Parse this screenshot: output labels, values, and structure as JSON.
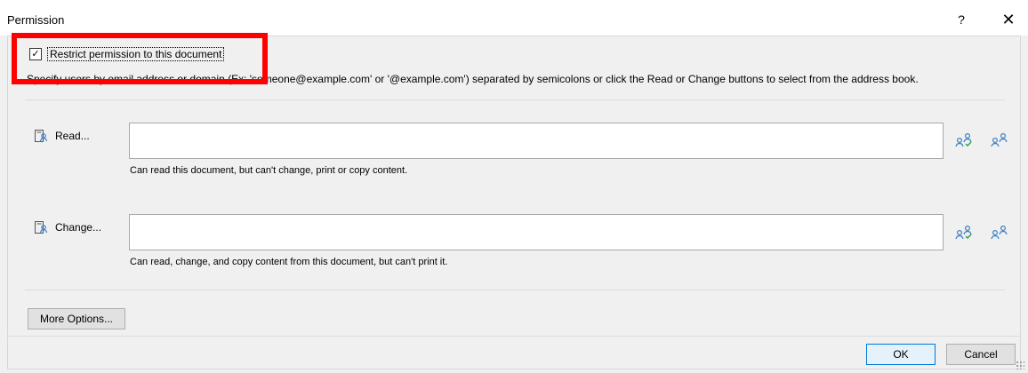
{
  "window": {
    "title": "Permission",
    "help_glyph": "?",
    "close_glyph": "✕"
  },
  "restrict": {
    "checked": true,
    "check_glyph": "✓",
    "label": "Restrict permission to this document"
  },
  "instructions": "Specify users by email address or domain (Ex: 'someone@example.com' or '@example.com') separated by semicolons or click the Read or Change buttons to select from the address book.",
  "read": {
    "button_label": "Read...",
    "icon": "address-book-icon",
    "value": "",
    "description": "Can read this document, but can't change, print or copy content.",
    "check_names_icon": "check-names-icon",
    "address_book_icon": "people-icon"
  },
  "change": {
    "button_label": "Change...",
    "icon": "address-book-icon",
    "value": "",
    "description": "Can read, change, and copy content from this document, but can't print it.",
    "check_names_icon": "check-names-icon",
    "address_book_icon": "people-icon"
  },
  "buttons": {
    "more_options": "More Options...",
    "ok": "OK",
    "cancel": "Cancel"
  },
  "colors": {
    "highlight": "#ff0000",
    "accent": "#0078d7",
    "icon_blue": "#3b7fc4",
    "icon_green": "#2e9e3e"
  }
}
